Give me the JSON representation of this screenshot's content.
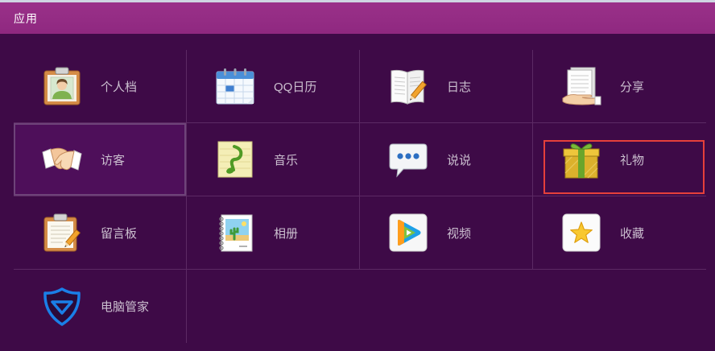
{
  "header": {
    "title": "应用"
  },
  "apps": [
    {
      "label": "个人档",
      "icon": "profile-clipboard-icon"
    },
    {
      "label": "QQ日历",
      "icon": "calendar-icon"
    },
    {
      "label": "日志",
      "icon": "journal-notebook-icon"
    },
    {
      "label": "分享",
      "icon": "share-document-hand-icon"
    },
    {
      "label": "访客",
      "icon": "handshake-icon",
      "selected": true
    },
    {
      "label": "音乐",
      "icon": "music-note-icon"
    },
    {
      "label": "说说",
      "icon": "speech-bubble-icon"
    },
    {
      "label": "礼物",
      "icon": "gift-box-icon",
      "annotated": true
    },
    {
      "label": "留言板",
      "icon": "message-board-clipboard-icon"
    },
    {
      "label": "相册",
      "icon": "photo-album-icon"
    },
    {
      "label": "视频",
      "icon": "video-play-icon"
    },
    {
      "label": "收藏",
      "icon": "star-favorite-icon"
    },
    {
      "label": "电脑管家",
      "icon": "shield-pc-manager-icon"
    }
  ],
  "colors": {
    "header_bg": "#8f2880",
    "header_text": "#ffffff",
    "panel_bg": "#3e0a47",
    "grid_line": "#5c2a64",
    "selected_tile_bg": "#4e0f5a",
    "label_text": "#cbbfcf",
    "annotation_box": "#e5403b"
  }
}
